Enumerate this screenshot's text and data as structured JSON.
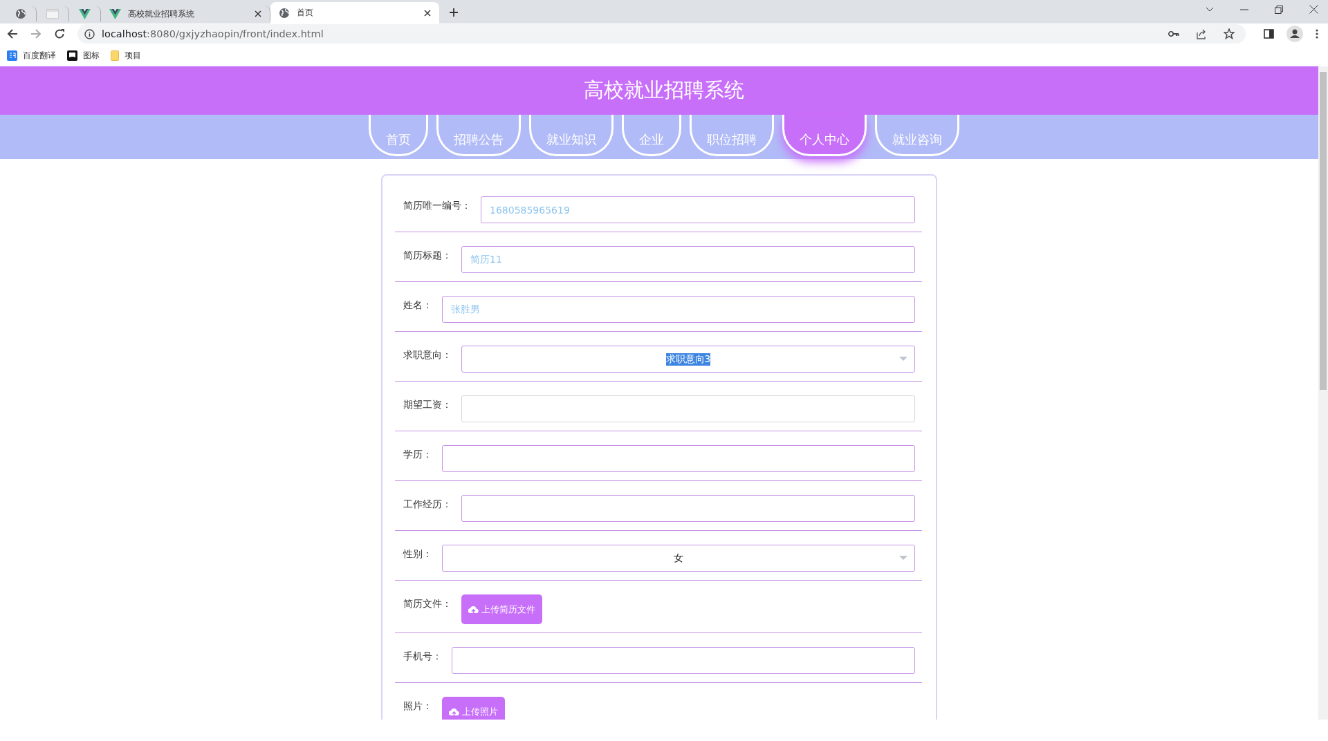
{
  "browser": {
    "tabs": [
      {
        "kind": "globe",
        "selected": false
      },
      {
        "kind": "blank",
        "selected": false
      },
      {
        "kind": "vue",
        "selected": false
      },
      {
        "kind": "vue",
        "title": "高校就业招聘系统",
        "selected": false
      },
      {
        "kind": "globe",
        "title": "首页",
        "selected": true
      }
    ],
    "url_host": "localhost",
    "url_rest": ":8080/gxjyzhaopin/front/index.html",
    "bookmarks": [
      {
        "kind": "translate",
        "label": "百度翻译"
      },
      {
        "kind": "flag",
        "label": "图标"
      },
      {
        "kind": "folder",
        "label": "项目"
      }
    ]
  },
  "site_title": "高校就业招聘系统",
  "nav": [
    {
      "label": "首页",
      "selected": false
    },
    {
      "label": "招聘公告",
      "selected": false
    },
    {
      "label": "就业知识",
      "selected": false
    },
    {
      "label": "企业",
      "selected": false
    },
    {
      "label": "职位招聘",
      "selected": false
    },
    {
      "label": "个人中心",
      "selected": true
    },
    {
      "label": "就业咨询",
      "selected": false
    }
  ],
  "form": [
    {
      "kind": "input",
      "label": "简历唯一编号：",
      "value": "1680585965619",
      "focused": false
    },
    {
      "kind": "input",
      "label": "简历标题：",
      "value": "简历11",
      "focused": false
    },
    {
      "kind": "input",
      "label": "姓名：",
      "value": "张胜男",
      "focused": false
    },
    {
      "kind": "select",
      "label": "求职意向：",
      "value": "求职意向3",
      "text_selected": true
    },
    {
      "kind": "input",
      "label": "期望工资：",
      "focused": true
    },
    {
      "kind": "input",
      "label": "学历：",
      "focused": false
    },
    {
      "kind": "input",
      "label": "工作经历：",
      "focused": false
    },
    {
      "kind": "select",
      "label": "性别：",
      "value": "女",
      "text_selected": false
    },
    {
      "kind": "upload",
      "label": "简历文件：",
      "button": "上传简历文件"
    },
    {
      "kind": "input",
      "label": "手机号：",
      "focused": false
    },
    {
      "kind": "upload",
      "label": "照片：",
      "button": "上传照片"
    }
  ]
}
